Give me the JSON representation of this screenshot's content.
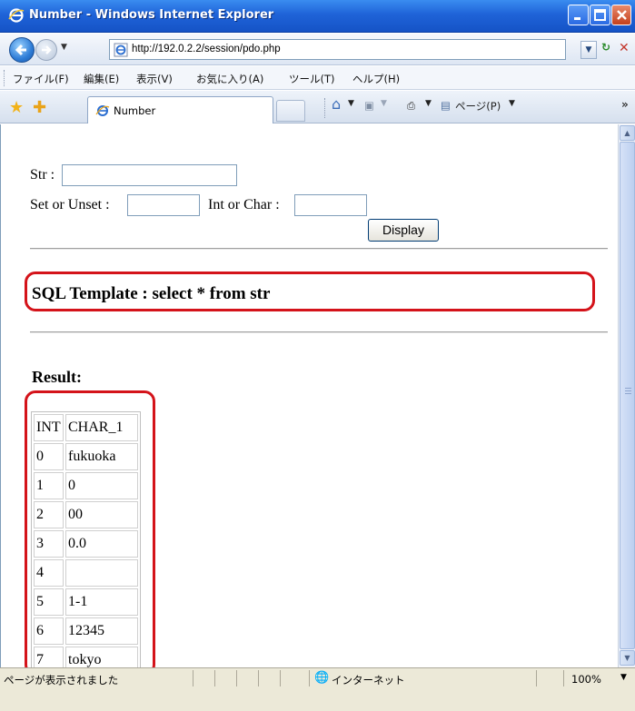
{
  "window": {
    "title": "Number - Windows Internet Explorer"
  },
  "address_bar": {
    "url": "http://192.0.2.2/session/pdo.php"
  },
  "menu": {
    "items": [
      "ファイル(F)",
      "編集(E)",
      "表示(V)",
      "お気に入り(A)",
      "ツール(T)",
      "ヘルプ(H)"
    ]
  },
  "tabs": [
    {
      "label": "Number"
    }
  ],
  "command_bar": {
    "page_label": "ページ(P)"
  },
  "form": {
    "str_label": "Str :",
    "str_value": "",
    "set_unset_label": "Set or Unset :",
    "set_unset_value": "",
    "int_char_label": "Int or Char :",
    "int_char_value": "",
    "display_button": "Display"
  },
  "sql_template": "SQL Template : select * from str",
  "result": {
    "heading": "Result:",
    "columns": [
      "INT",
      "CHAR_1"
    ],
    "rows": [
      [
        "0",
        "fukuoka"
      ],
      [
        "1",
        "0"
      ],
      [
        "2",
        "00"
      ],
      [
        "3",
        "0.0"
      ],
      [
        "4",
        ""
      ],
      [
        "5",
        "1-1"
      ],
      [
        "6",
        "12345"
      ],
      [
        "7",
        "tokyo"
      ]
    ]
  },
  "status_bar": {
    "message": "ページが表示されました",
    "zone": "インターネット",
    "zoom": "100%"
  },
  "colors": {
    "highlight_border": "#d4131a",
    "titlebar": "#1f63d8"
  }
}
